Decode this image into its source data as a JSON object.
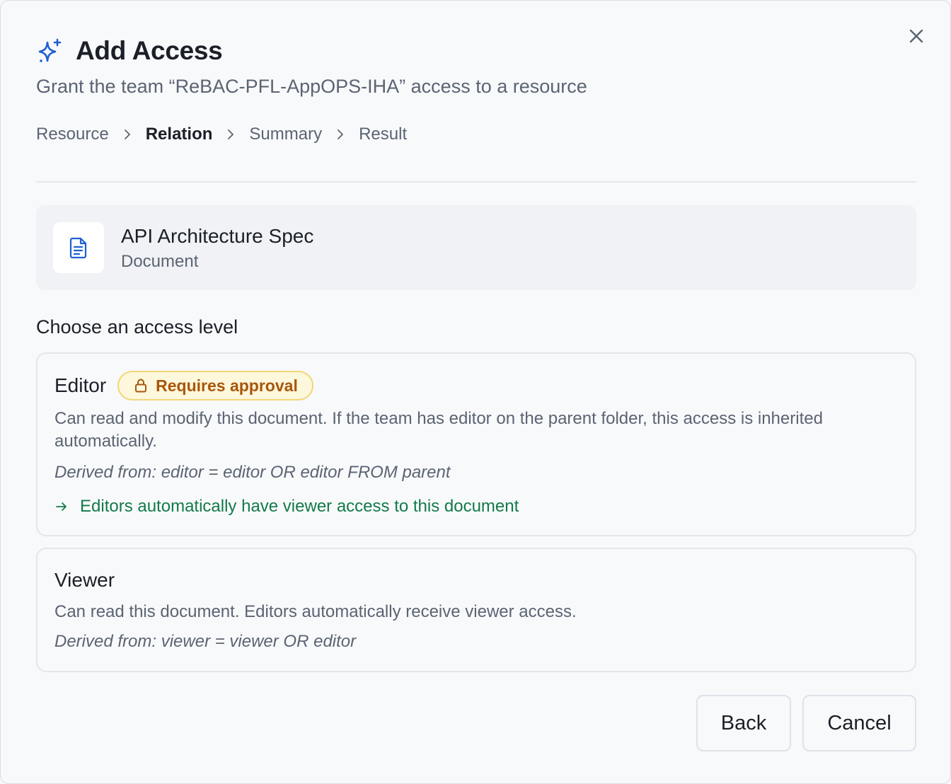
{
  "dialog": {
    "title": "Add Access",
    "subtitle": "Grant the team “ReBAC-PFL-AppOPS-IHA” access to a resource"
  },
  "breadcrumb": {
    "steps": [
      "Resource",
      "Relation",
      "Summary",
      "Result"
    ],
    "active_step": "Relation"
  },
  "resource": {
    "name": "API Architecture Spec",
    "type": "Document",
    "icon": "document-icon"
  },
  "access_section": {
    "title": "Choose an access level",
    "options": [
      {
        "title": "Editor",
        "badge": "Requires approval",
        "badge_icon": "lock-icon",
        "description": "Can read and modify this document. If the team has editor on the parent folder, this access is inherited automatically.",
        "derived": "Derived from: editor = editor OR editor FROM parent",
        "note": "Editors automatically have viewer access to this document",
        "note_icon": "arrow-right-icon"
      },
      {
        "title": "Viewer",
        "description": "Can read this document. Editors automatically receive viewer access.",
        "derived": "Derived from: viewer = viewer OR editor"
      }
    ]
  },
  "footer": {
    "back_label": "Back",
    "cancel_label": "Cancel"
  },
  "colors": {
    "accent": "#1f5fd1",
    "badge_text": "#a8570a",
    "badge_bg": "#fdf7dc",
    "note_green": "#137a4a"
  }
}
